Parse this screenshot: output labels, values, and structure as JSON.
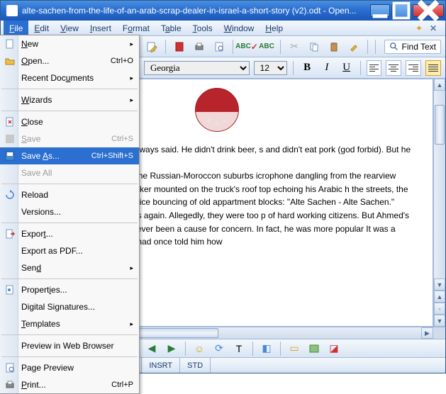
{
  "window": {
    "title": "alte-sachen-from-the-life-of-an-arab-scrap-dealer-in-israel-a-short-story (v2).odt - Open..."
  },
  "menubar": {
    "items": [
      "File",
      "Edit",
      "View",
      "Insert",
      "Format",
      "Table",
      "Tools",
      "Window",
      "Help"
    ]
  },
  "find": {
    "label": "Find Text"
  },
  "font": {
    "name": "Georgia",
    "size": "12"
  },
  "dropdown": {
    "new": "New",
    "open": "Open...",
    "open_accel": "Ctrl+O",
    "recent": "Recent Documents",
    "wizards": "Wizards",
    "close": "Close",
    "save": "Save",
    "save_accel": "Ctrl+S",
    "saveas": "Save As...",
    "saveas_accel": "Ctrl+Shift+S",
    "saveall": "Save All",
    "reload": "Reload",
    "versions": "Versions...",
    "export": "Export...",
    "exportpdf": "Export as PDF...",
    "send": "Send",
    "properties": "Properties...",
    "digsig": "Digital Signatures...",
    "templates": "Templates",
    "preview_browser": "Preview in Web Browser",
    "page_preview": "Page Preview",
    "print": "Print...",
    "print_accel": "Ctrl+P"
  },
  "document": {
    "p1": "n than the Germans,\" his client always said. He didn't drink beer, s and didn't eat pork (god forbid). But he was never late. And he'd gle fact.",
    "p2": "olkswagen pickup truck through the Russian-Moroccon suburbs icrophone dangling from the rearview mirror: \"Alte Sachen - Alte d speaker mounted on the truck's roof top echoing his Arabic h the streets, the amplified and slightly distorted voice bouncing of old appartment blocks: \"Alte Sachen - Alte Sachen.\"",
    "p3": "ed complaints about the mosques again. Allegedly, they were too p of hard working citizens. But Ahmed's speaker mounted on top n had never been a cause for concern. In fact, he was more popular It was a traditional thing. His grandfather had once told him how"
  },
  "status": {
    "lang": "SA)",
    "insrt": "INSRT",
    "std": "STD"
  }
}
